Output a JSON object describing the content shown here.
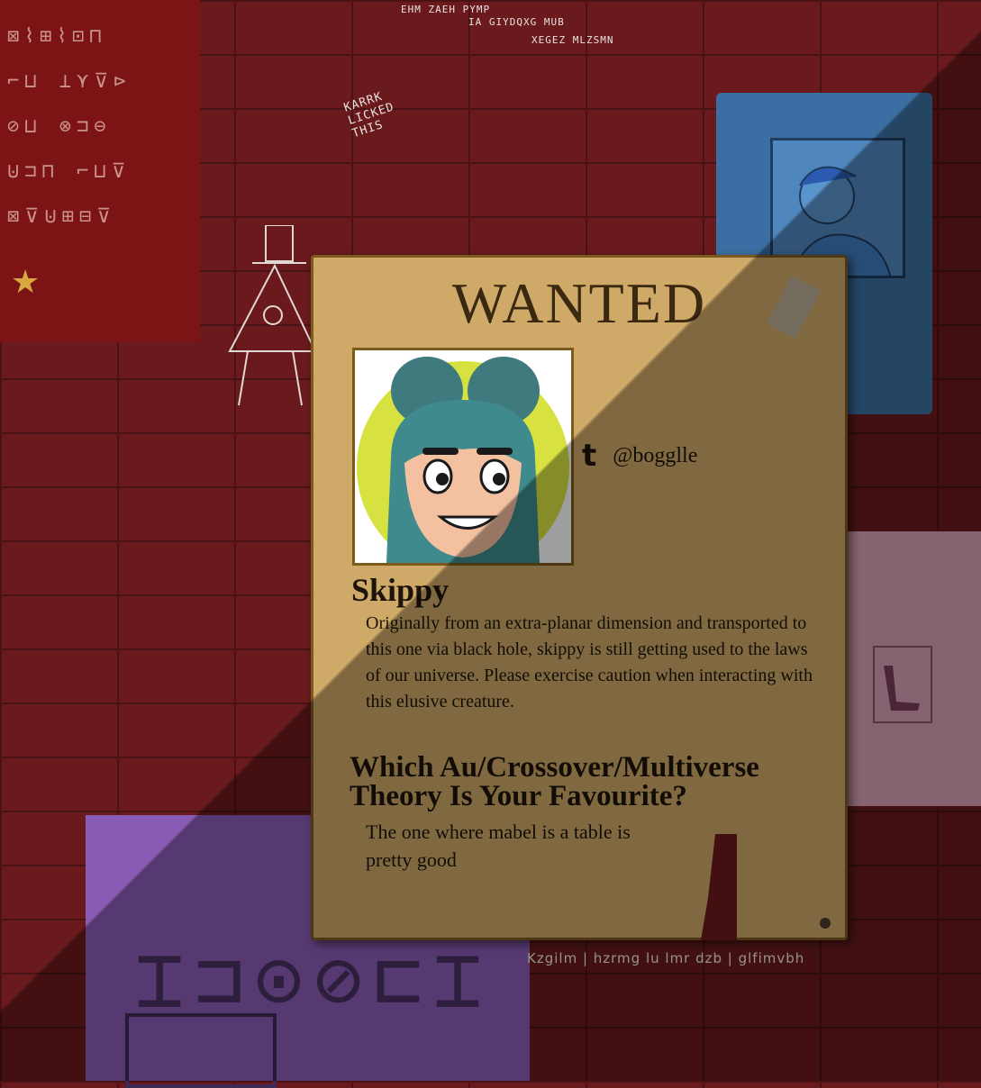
{
  "poster": {
    "title": "WANTED",
    "social_handle": "@bogglle",
    "social_icon": "tumblr-icon",
    "name": "Skippy",
    "bio": "Originally from an extra-planar dimension and transported to this one via black hole, skippy is still getting used to the laws of our universe. Please exercise caution when interacting with this elusive creature.",
    "question": "Which Au/Crossover/Multiverse Theory Is Your Favourite?",
    "answer": "The one where mabel is a table is pretty good"
  },
  "wall": {
    "top_line_1": "EHM ZAEH PYMP",
    "top_line_2": "IA GIYDQXG MUB",
    "top_line_3": "XEGEZ MLZSMN",
    "graffiti": "KARRK LICKED THIS",
    "bottom_strip": "Kzgilm | hzrmg lu lmr dzb | glfimvbh"
  },
  "colors": {
    "wall": "#6a1a1c",
    "parchment": "#cfa968",
    "ink": "#1c1408",
    "blue_poster": "#3b6fa3",
    "pink_poster": "#d8a0b5",
    "purple_poster": "#8a5cb5",
    "red_poster": "#7c1416"
  }
}
